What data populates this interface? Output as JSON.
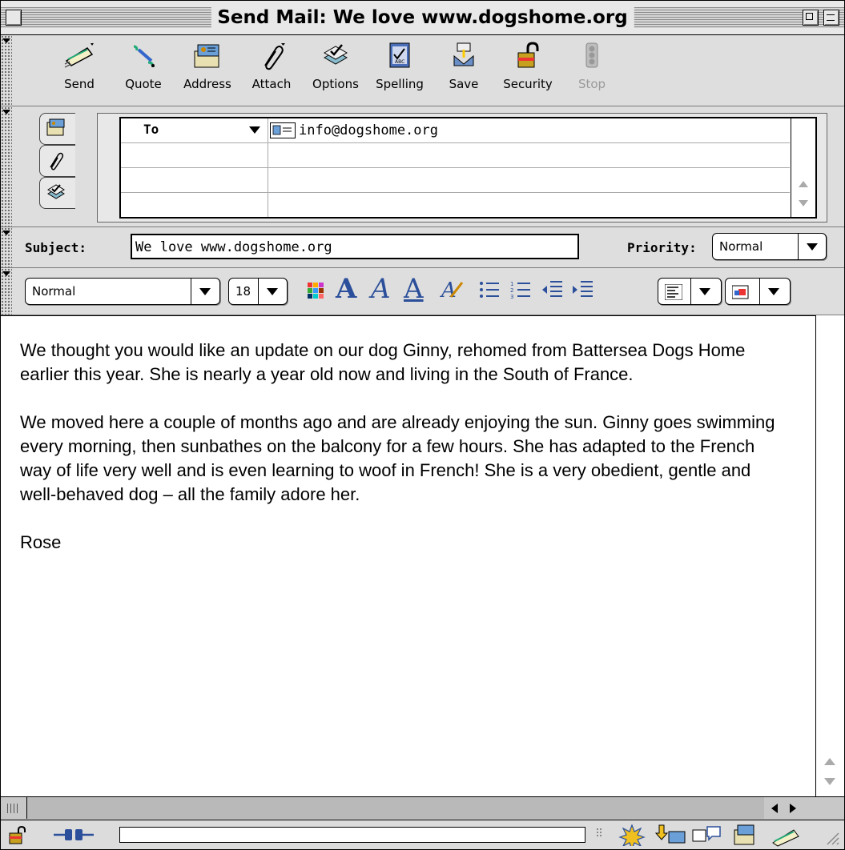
{
  "window": {
    "title": "Send Mail: We love www.dogshome.org"
  },
  "toolbar": {
    "buttons": [
      {
        "label": "Send",
        "icon": "send-icon"
      },
      {
        "label": "Quote",
        "icon": "quote-icon"
      },
      {
        "label": "Address",
        "icon": "address-book-icon"
      },
      {
        "label": "Attach",
        "icon": "paperclip-icon"
      },
      {
        "label": "Options",
        "icon": "options-icon"
      },
      {
        "label": "Spelling",
        "icon": "spelling-icon"
      },
      {
        "label": "Save",
        "icon": "save-icon"
      },
      {
        "label": "Security",
        "icon": "padlock-icon"
      },
      {
        "label": "Stop",
        "icon": "stop-icon",
        "disabled": true
      }
    ]
  },
  "address": {
    "rows": [
      {
        "type": "To",
        "value": "info@dogshome.org"
      },
      {
        "type": "",
        "value": ""
      },
      {
        "type": "",
        "value": ""
      },
      {
        "type": "",
        "value": ""
      }
    ]
  },
  "subject": {
    "label": "Subject:",
    "value": "We love www.dogshome.org"
  },
  "priority": {
    "label": "Priority:",
    "value": "Normal"
  },
  "format": {
    "paragraph_style": "Normal",
    "font_size": "18"
  },
  "body": {
    "paragraphs": [
      "We thought you would like an update on our dog Ginny, rehomed from Battersea Dogs Home earlier this year. She is nearly a year old now and living in the South of France.",
      "We moved here a couple of months ago and are already enjoying the sun. Ginny goes swimming every morning, then sunbathes on the balcony for a few hours. She has adapted to the French way of life very well and is even learning to woof in French! She is a very obedient, gentle and well-behaved dog – all the family adore her.",
      "Rose"
    ]
  },
  "colors": {
    "chrome": "#dcdcdc",
    "body_background": "#ffffff",
    "text": "#000000",
    "disabled_label": "#9a9a9a"
  }
}
